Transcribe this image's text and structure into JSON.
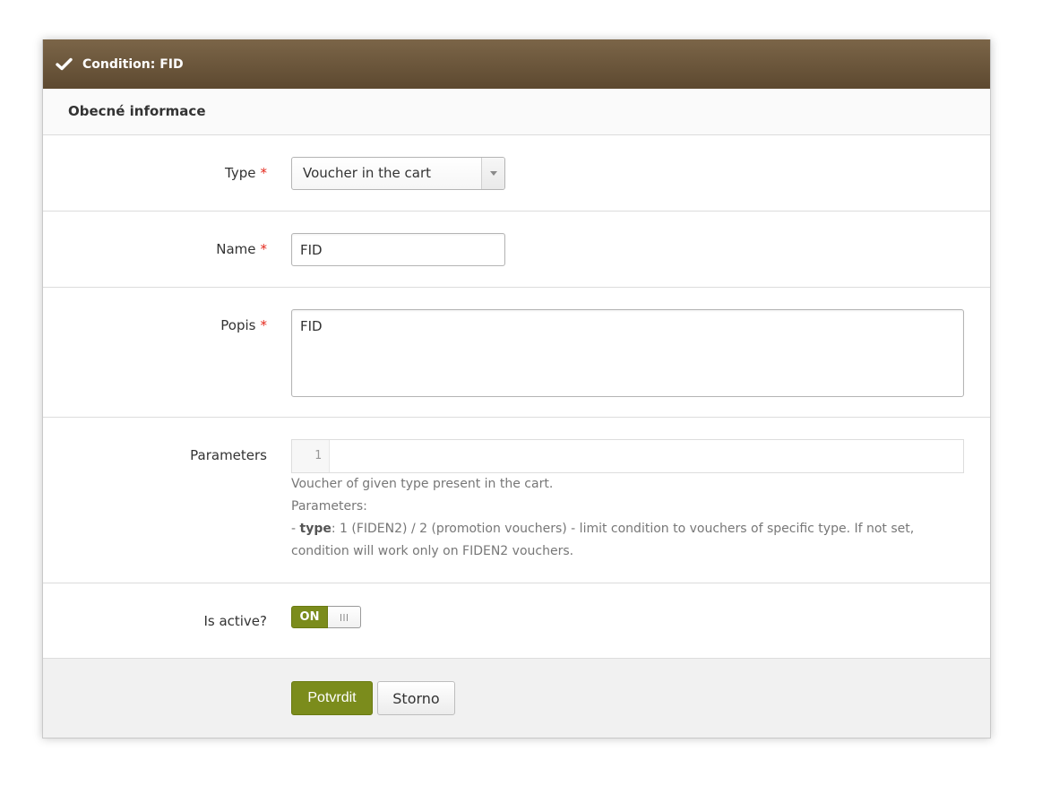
{
  "panel": {
    "title": "Condition: FID",
    "title_icon": "check-icon",
    "section_title": "Obecné informace"
  },
  "form": {
    "required_marker": "*",
    "type": {
      "label": "Type",
      "value": "Voucher in the cart"
    },
    "name": {
      "label": "Name",
      "value": "FID"
    },
    "popis": {
      "label": "Popis",
      "value": "FID"
    },
    "parameters": {
      "label": "Parameters",
      "editor_line_number": "1",
      "help_intro": "Voucher of given type present in the cart.",
      "help_heading": "Parameters:",
      "help_item_prefix": "- ",
      "help_item_name": "type",
      "help_item_desc": ": 1 (FIDEN2) / 2 (promotion vouchers) - limit condition to vouchers of specific type. If not set, condition will work only on FIDEN2 vouchers."
    },
    "is_active": {
      "label": "Is active?",
      "state_label": "ON",
      "checked": true
    }
  },
  "actions": {
    "submit_label": "Potvrdit",
    "cancel_label": "Storno"
  },
  "colors": {
    "header-top": "#7b6548",
    "header-bottom": "#5d4930",
    "accent": "#7b8c1c",
    "required": "#e4281c"
  }
}
